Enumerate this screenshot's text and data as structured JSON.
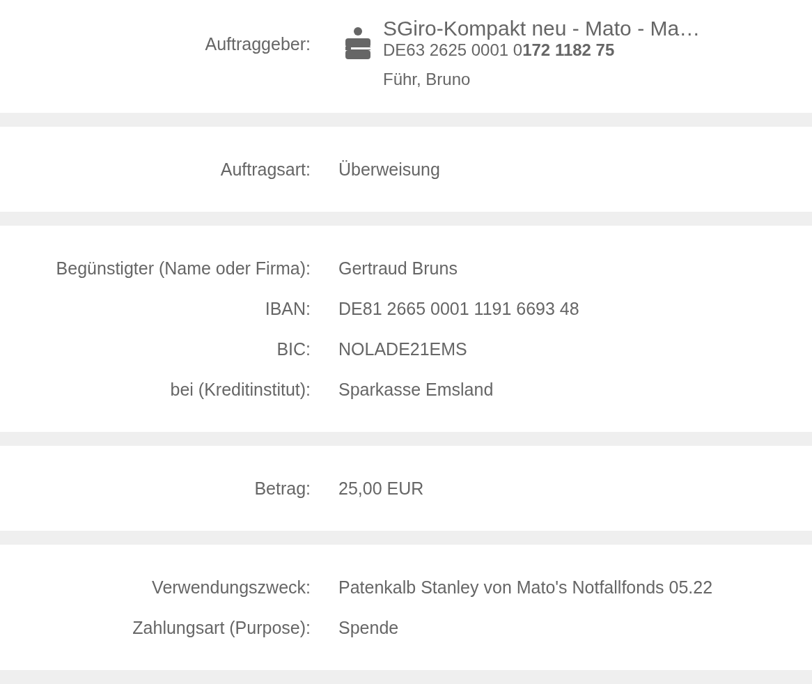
{
  "sections": [
    {
      "rows": [
        {
          "kind": "account",
          "label": "Auftraggeber:",
          "account_name": "SGiro-Kompakt neu - Mato - Ma…",
          "iban": "DE63 2625 0001 0**172 1182 75**",
          "holder": "Führ, Bruno"
        }
      ]
    },
    {
      "rows": [
        {
          "kind": "text",
          "label": "Auftragsart:",
          "value": "Überweisung"
        }
      ]
    },
    {
      "rows": [
        {
          "kind": "text",
          "label": "Begünstigter (Name oder Firma):",
          "value": "Gertraud Bruns"
        },
        {
          "kind": "text",
          "label": "IBAN:",
          "value": "DE81 2665 0001 1191 6693 48"
        },
        {
          "kind": "text",
          "label": "BIC:",
          "value": "NOLADE21EMS"
        },
        {
          "kind": "text",
          "label": "bei (Kreditinstitut):",
          "value": "Sparkasse Emsland"
        }
      ]
    },
    {
      "rows": [
        {
          "kind": "text",
          "label": "Betrag:",
          "value": "25,00 EUR"
        }
      ]
    },
    {
      "rows": [
        {
          "kind": "text",
          "label": "Verwendungszweck:",
          "value": "Patenkalb Stanley von Mato's Notfallfonds 05.22"
        },
        {
          "kind": "text",
          "label": "Zahlungsart (Purpose):",
          "value": "Spende"
        }
      ]
    }
  ]
}
